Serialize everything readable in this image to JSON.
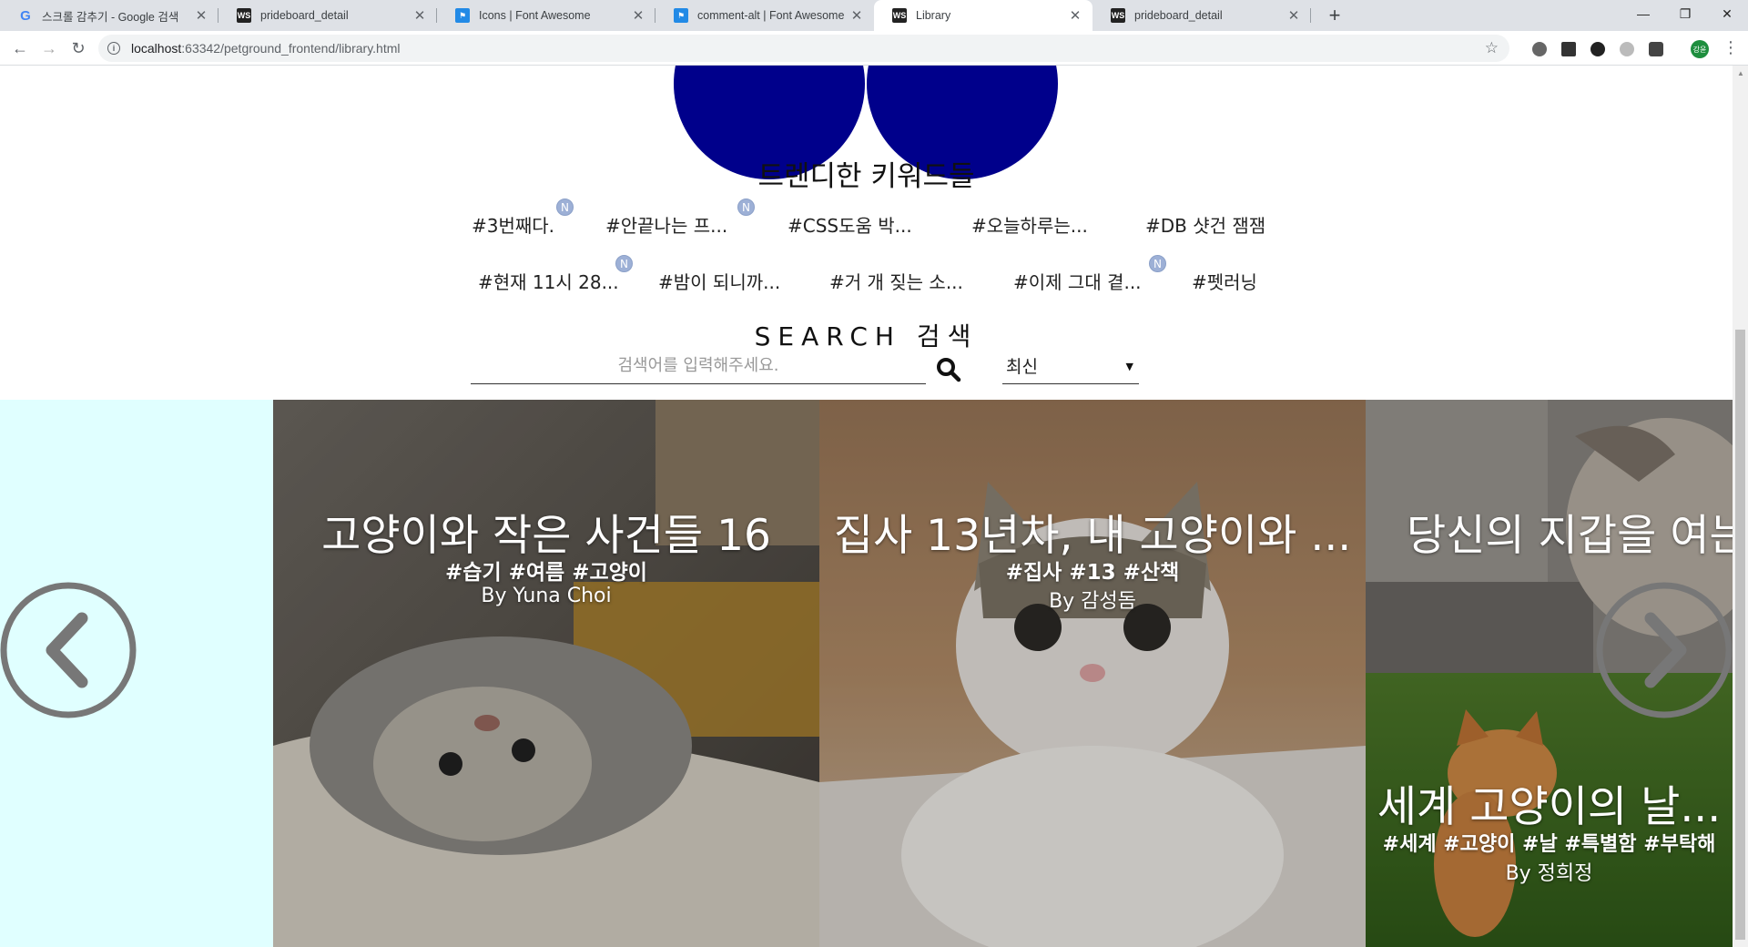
{
  "browser": {
    "tabs": [
      {
        "title": "스크롤 감추기 - Google 검색",
        "favicon": "google-g-icon"
      },
      {
        "title": "prideboard_detail",
        "favicon": "webstorm-icon"
      },
      {
        "title": "Icons | Font Awesome",
        "favicon": "font-awesome-flag-icon"
      },
      {
        "title": "comment-alt | Font Awesome",
        "favicon": "font-awesome-flag-icon"
      },
      {
        "title": "Library",
        "favicon": "webstorm-icon"
      },
      {
        "title": "prideboard_detail",
        "favicon": "webstorm-icon"
      }
    ],
    "active_tab": 4,
    "address": {
      "host": "localhost",
      "path": ":63342/petground_frontend/library.html"
    },
    "profile_initial": "강윤"
  },
  "trending": {
    "title": "트렌디한 키워드들",
    "keywords_row1": [
      {
        "text": "#3번째다.",
        "new": true
      },
      {
        "text": "#안끝나는 프...",
        "new": true
      },
      {
        "text": "#CSS도움 박...",
        "new": false
      },
      {
        "text": "#오늘하루는...",
        "new": false
      },
      {
        "text": "#DB 샷건 잼잼",
        "new": false
      }
    ],
    "keywords_row2": [
      {
        "text": "#현재 11시 28...",
        "new": true
      },
      {
        "text": "#밤이 되니까...",
        "new": false
      },
      {
        "text": "#거 개 짖는 소...",
        "new": false
      },
      {
        "text": "#이제 그대 곁...",
        "new": true
      },
      {
        "text": "#펫러닝",
        "new": false
      }
    ],
    "new_badge": "N"
  },
  "search": {
    "title": "SEARCH 검색",
    "placeholder": "검색어를 입력해주세요.",
    "sort_value": "최신"
  },
  "cards": [
    {
      "title": "고양이와 작은 사건들 16",
      "tags": "#습기 #여름 #고양이",
      "author": "By Yuna Choi"
    },
    {
      "title": "집사 13년차, 내 고양이와 ...",
      "tags": "#집사 #13 #산책",
      "author": "By 감성돔"
    },
    {
      "title": "당신의 지갑을 여는",
      "tags": "",
      "author": ""
    },
    {
      "title": "세계 고양이의 날...",
      "tags": "#세계 #고양이 #날 #특별함 #부탁해",
      "author": "By 정희정"
    }
  ],
  "colors": {
    "circle": "#00008b",
    "side_panel": "#e0ffff",
    "new_badge": "#9db0d6",
    "arrow": "#777777"
  }
}
